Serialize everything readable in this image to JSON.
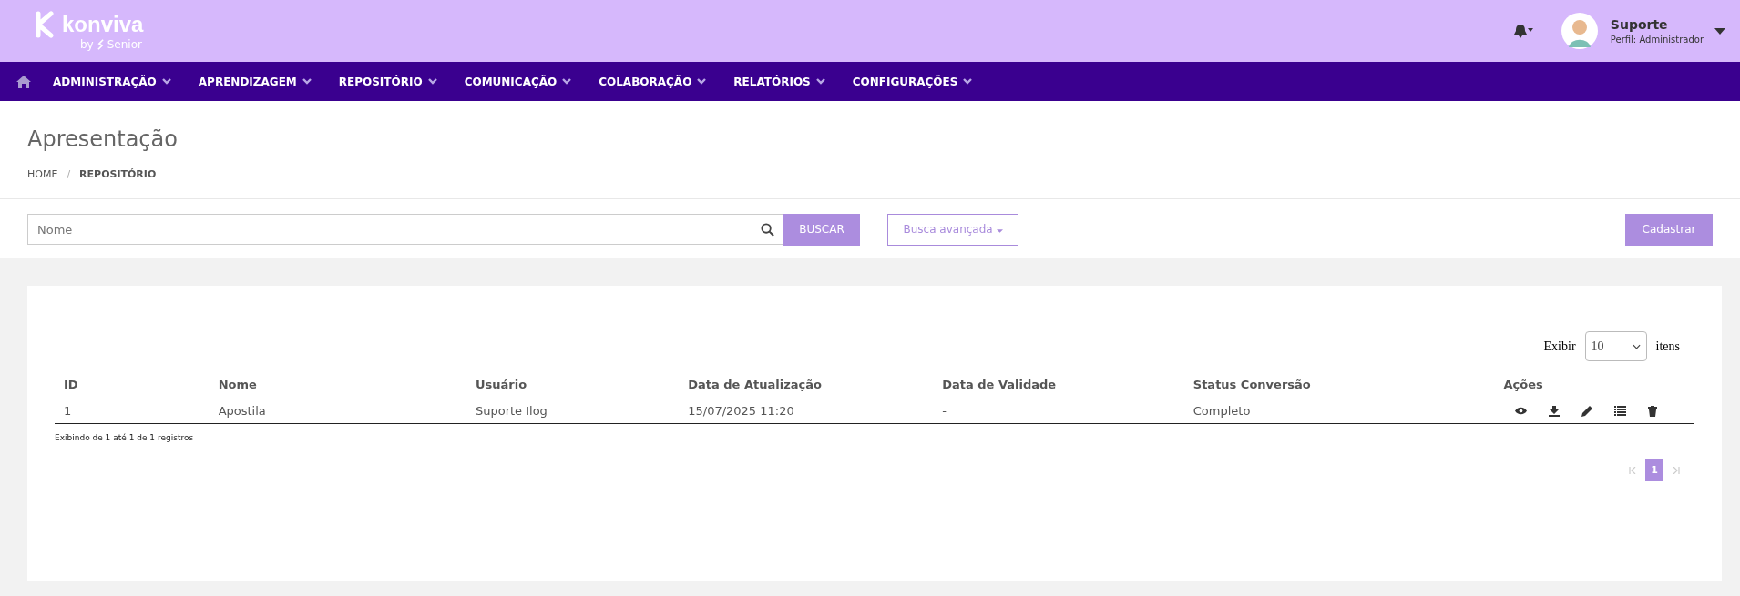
{
  "brand": {
    "name": "konviva",
    "byline": "by",
    "partner": "Senior"
  },
  "user": {
    "name": "Suporte",
    "profile": "Perfil: Administrador"
  },
  "nav": [
    {
      "label": "ADMINISTRAÇÃO"
    },
    {
      "label": "APRENDIZAGEM"
    },
    {
      "label": "REPOSITÓRIO"
    },
    {
      "label": "COMUNICAÇÃO"
    },
    {
      "label": "COLABORAÇÃO"
    },
    {
      "label": "RELATÓRIOS"
    },
    {
      "label": "CONFIGURAÇÕES"
    }
  ],
  "page": {
    "title": "Apresentação",
    "breadcrumb_separator": "/",
    "breadcrumb": [
      {
        "label": "HOME",
        "current": false
      },
      {
        "label": "REPOSITÓRIO",
        "current": true
      }
    ]
  },
  "search": {
    "placeholder": "Nome",
    "button": "BUSCAR",
    "advanced": "Busca avançada",
    "create": "Cadastrar"
  },
  "page_size": {
    "label": "Exibir",
    "value": "10",
    "suffix": "itens"
  },
  "table": {
    "columns": [
      "ID",
      "Nome",
      "Usuário",
      "Data de Atualização",
      "Data de Validade",
      "Status Conversão",
      "Ações"
    ],
    "rows": [
      {
        "cells": [
          "1",
          "Apostila",
          "Suporte Ilog",
          "15/07/2025 11:20",
          "-",
          "Completo"
        ],
        "actions": [
          {
            "kind": "view"
          },
          {
            "kind": "download"
          },
          {
            "kind": "edit"
          },
          {
            "kind": "list"
          },
          {
            "kind": "delete"
          }
        ]
      }
    ]
  },
  "summary": "Exibindo de 1 até 1 de 1 registros",
  "pagination": {
    "pages": [
      {
        "label": "1",
        "selected": true
      }
    ]
  }
}
